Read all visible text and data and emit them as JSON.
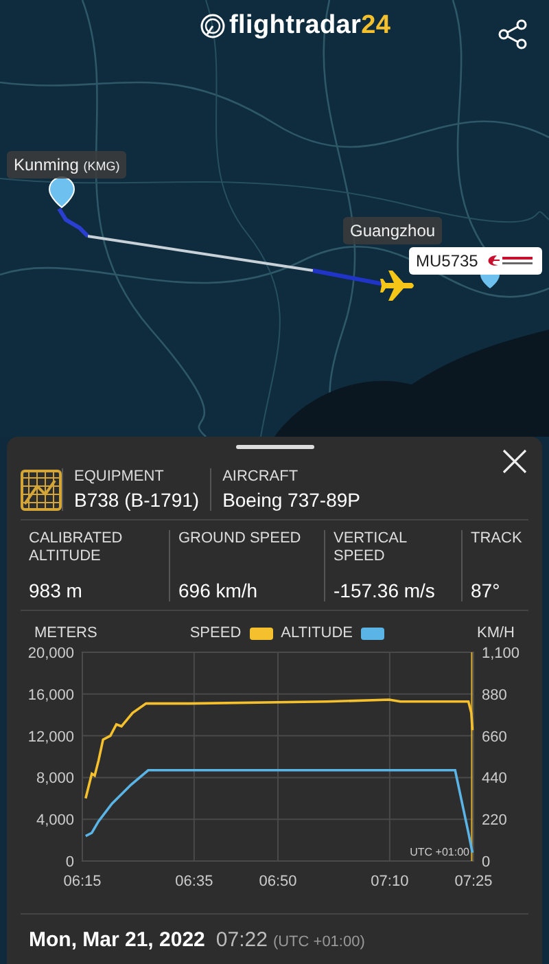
{
  "header": {
    "logo": {
      "main": "flightradar",
      "accent": "24"
    }
  },
  "map": {
    "origin": {
      "name": "Kunming",
      "code": "(KMG)"
    },
    "destination": {
      "name": "Guangzhou"
    },
    "callout": {
      "flight": "MU5735"
    }
  },
  "panel": {
    "equipment": {
      "label": "EQUIPMENT",
      "value": "B738 (B-1791)"
    },
    "aircraft": {
      "label": "AIRCRAFT",
      "value": "Boeing 737-89P"
    },
    "stats": [
      {
        "label": "CALIBRATED ALTITUDE",
        "value": "983 m"
      },
      {
        "label": "GROUND SPEED",
        "value": "696 km/h"
      },
      {
        "label": "VERTICAL SPEED",
        "value": "-157.36 m/s"
      },
      {
        "label": "TRACK",
        "value": "87°"
      }
    ],
    "chart": {
      "left_unit": "METERS",
      "right_unit": "KM/H",
      "timezone": "UTC +01:00",
      "chart_data": {
        "type": "line",
        "grid": true,
        "xlim": [
          375,
          445
        ],
        "ylim": [
          0,
          20000
        ],
        "y2lim": [
          0,
          1100
        ],
        "xticks": [
          {
            "value": 375,
            "label": "06:15"
          },
          {
            "value": 395,
            "label": "06:35"
          },
          {
            "value": 410,
            "label": "06:50"
          },
          {
            "value": 430,
            "label": "07:10"
          },
          {
            "value": 445,
            "label": "07:25"
          }
        ],
        "yticks": [
          {
            "value": 0,
            "label": "0"
          },
          {
            "value": 4000,
            "label": "4,000"
          },
          {
            "value": 8000,
            "label": "8,000"
          },
          {
            "value": 12000,
            "label": "12,000"
          },
          {
            "value": 16000,
            "label": "16,000"
          },
          {
            "value": 20000,
            "label": "20,000"
          }
        ],
        "y2ticks": [
          {
            "value": 0,
            "label": "0"
          },
          {
            "value": 220,
            "label": "220"
          },
          {
            "value": 440,
            "label": "440"
          },
          {
            "value": 660,
            "label": "660"
          },
          {
            "value": 880,
            "label": "880"
          },
          {
            "value": 1100,
            "label": "1,100"
          }
        ],
        "series": [
          {
            "name": "SPEED",
            "color": "#f5c02e",
            "axis": "y2",
            "x": [
              375.6,
              376.7,
              377.2,
              377.9,
              378.7,
              380,
              381.1,
              382,
              384,
              386.4,
              394.2,
              418.8,
              429.9,
              431.9,
              441.7,
              444.1,
              444.6,
              444.8
            ],
            "values": [
              330,
              460,
              450,
              530,
              640,
              660,
              720,
              710,
              780,
              830,
              830,
              840,
              850,
              840,
              840,
              840,
              780,
              690
            ]
          },
          {
            "name": "ALTITUDE",
            "color": "#5ab4e6",
            "x": [
              375.6,
              376.7,
              377.9,
              380.3,
              383.7,
              386.8,
              441.7,
              444.1,
              444.8
            ],
            "values": [
              2400,
              2700,
              3800,
              5500,
              7300,
              8700,
              8700,
              2700,
              800
            ]
          }
        ]
      }
    },
    "date": "Mon, Mar 21, 2022",
    "time": "07:22",
    "utc": "(UTC +01:00)"
  }
}
